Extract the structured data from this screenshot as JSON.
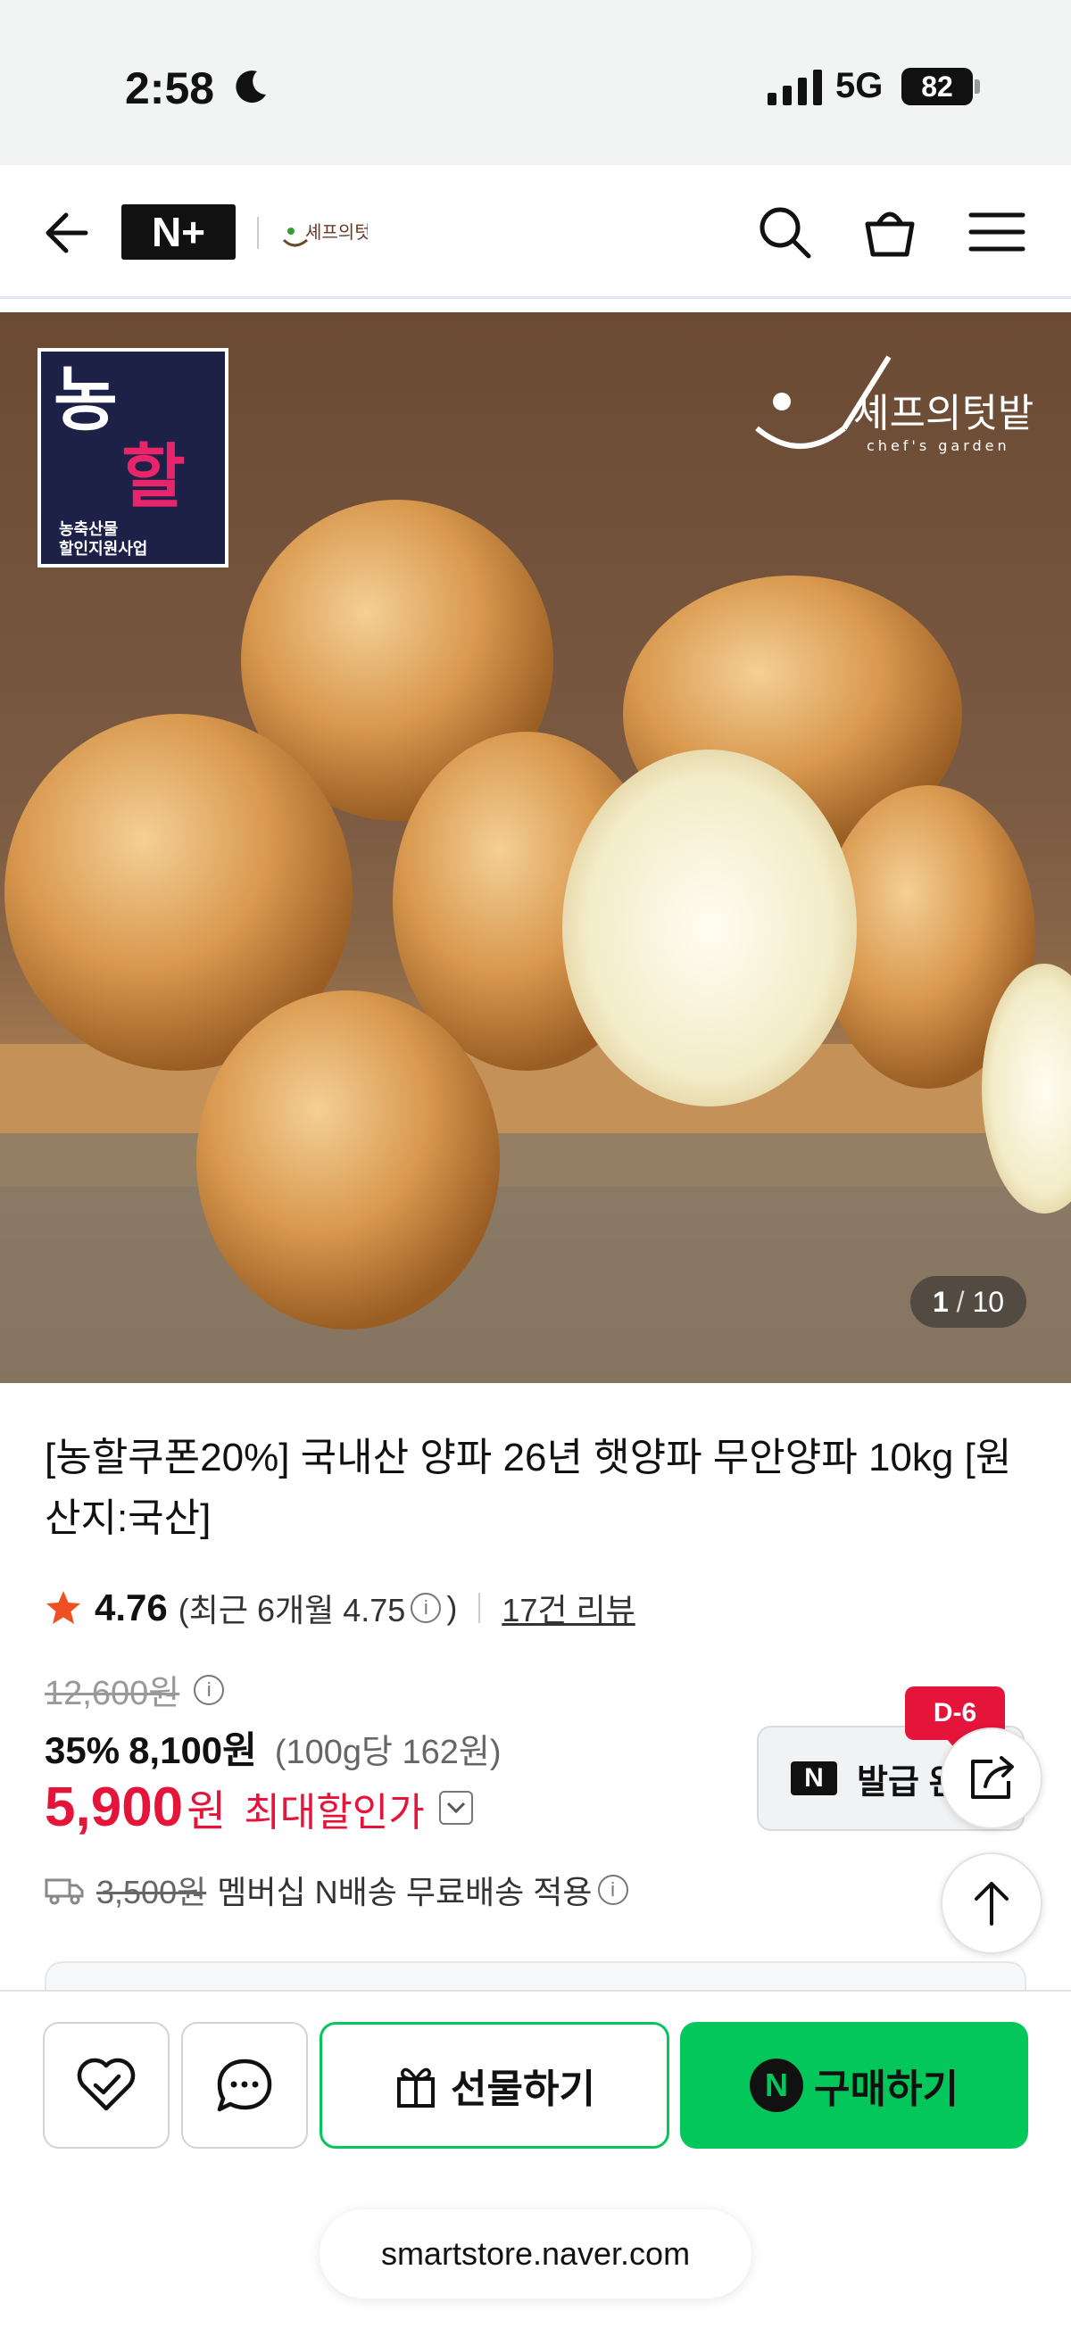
{
  "status_bar": {
    "time": "2:58",
    "network": "5G",
    "battery": "82"
  },
  "header": {
    "nplus_label": "N+",
    "brand_logo_text": "셰프의텃밭"
  },
  "hero": {
    "badge_line1": "농",
    "badge_line2": "할",
    "badge_caption1": "농축산물",
    "badge_caption2": "할인지원사업",
    "chef_logo_text": "셰프의텃밭",
    "chef_logo_sub": "chef's garden",
    "counter_current": "1",
    "counter_total": "10"
  },
  "product": {
    "title": "[농할쿠폰20%] 국내산 양파 26년 햇양파 무안양파 10kg [원산지:국산]",
    "rating": "4.76",
    "recent_rating": "(최근 6개월 4.75",
    "recent_rating_close": ")",
    "review_count": "17건 리뷰",
    "original_price": "12,600원",
    "discount_pct": "35%",
    "sale_price": "8,100원",
    "unit_price": "(100g당 162원)",
    "max_discount_amount": "5,900",
    "max_discount_won": "원",
    "max_discount_label": "최대할인가",
    "shipping_original": "3,500원",
    "shipping_text": "멤버십 N배송 무료배송 적용"
  },
  "coupon": {
    "n_mark": "N",
    "label": "발급 완",
    "dday": "D-6"
  },
  "bottom_bar": {
    "gift_label": "선물하기",
    "buy_label": "구매하기",
    "buy_n_mark": "N",
    "url": "smartstore.naver.com"
  },
  "colors": {
    "accent_green": "#03c75a",
    "price_red": "#e5143b",
    "rating_star": "#f04e23"
  }
}
